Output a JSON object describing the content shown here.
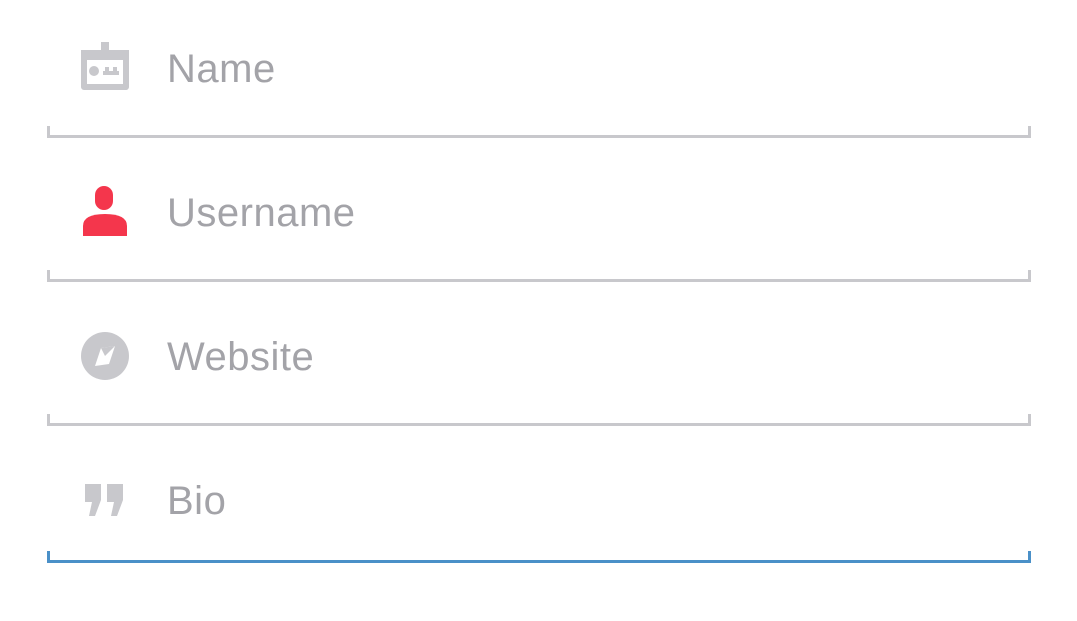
{
  "form": {
    "fields": [
      {
        "id": "name",
        "icon": "id-badge-icon",
        "placeholder": "Name",
        "icon_color": "#c8c8cc",
        "active": false
      },
      {
        "id": "username",
        "icon": "user-icon",
        "placeholder": "Username",
        "icon_color": "#f4364c",
        "active": false
      },
      {
        "id": "website",
        "icon": "compass-icon",
        "placeholder": "Website",
        "icon_color": "#c8c8cc",
        "active": false
      },
      {
        "id": "bio",
        "icon": "quote-icon",
        "placeholder": "Bio",
        "icon_color": "#c8c8cc",
        "active": true
      }
    ]
  },
  "colors": {
    "underline": "#c8c8cc",
    "underline_active": "#4a90c8",
    "placeholder_text": "#a3a3a8",
    "accent": "#f4364c"
  }
}
